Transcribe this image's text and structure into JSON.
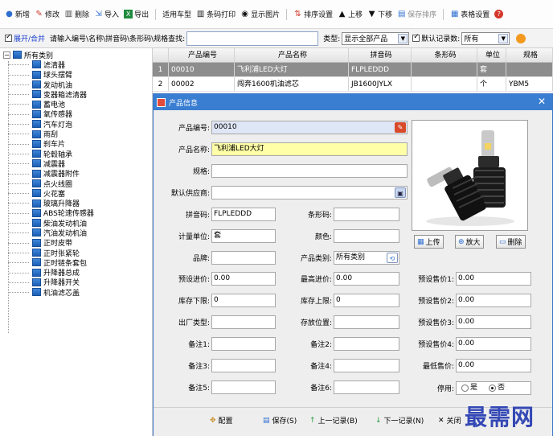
{
  "toolbar": {
    "items": [
      {
        "label": "新增",
        "icon": "add-circle-icon",
        "color": "#2f6fd1"
      },
      {
        "label": "修改",
        "icon": "pencil-icon",
        "color": "#d4382a"
      },
      {
        "label": "删除",
        "icon": "trash-icon",
        "color": "#444444"
      },
      {
        "label": "导入",
        "icon": "import-icon",
        "color": "#2f6fd1"
      },
      {
        "label": "导出",
        "icon": "excel-icon",
        "color": "#1e8a3c"
      },
      {
        "label": "适用车型",
        "icon": "",
        "color": ""
      },
      {
        "label": "条码打印",
        "icon": "barcode-icon",
        "color": "#222222"
      },
      {
        "label": "显示图片",
        "icon": "eye-icon",
        "color": "#222222"
      },
      {
        "label": "排序设置",
        "icon": "sort-icon",
        "color": "#d4382a"
      },
      {
        "label": "上移",
        "icon": "up-arrow-icon",
        "color": "#333333"
      },
      {
        "label": "下移",
        "icon": "down-arrow-icon",
        "color": "#333333"
      },
      {
        "label": "保存排序",
        "icon": "save-sort-icon",
        "color": "#2f6fd1"
      },
      {
        "label": "表格设置",
        "icon": "table-settings-icon",
        "color": "#2f6fd1"
      },
      {
        "label": "?",
        "icon": "help-icon",
        "color": "#d4382a"
      }
    ]
  },
  "filter": {
    "expand_label": "展开/合并",
    "search_label": "请输入编号\\名称\\拼音码\\条形码\\规格查找:",
    "type_label": "类型:",
    "type_value": "显示全部产品",
    "default_label": "默认记录数:",
    "default_value": "所有"
  },
  "tree": {
    "root": "所有类别",
    "items": [
      "滤清器",
      "球头摆臂",
      "发动机油",
      "变器箱滤清器",
      "蓄电池",
      "氧传感器",
      "汽车灯泡",
      "雨刮",
      "刹车片",
      "轮毂轴承",
      "减震器",
      "减震器附件",
      "点火线圈",
      "火花塞",
      "玻璃升降器",
      "ABS轮速传感器",
      "柴油发动机油",
      "汽油发动机油",
      "正时皮带",
      "正时张紧轮",
      "正时链条套包",
      "升降器总成",
      "升降器开关",
      "机油滤芯盖"
    ]
  },
  "grid": {
    "headers": [
      "",
      "产品编号",
      "产品名称",
      "拼音码",
      "条形码",
      "单位",
      "规格"
    ],
    "rows": [
      [
        "1",
        "00010",
        "飞利浦LED大灯",
        "FLPLEDDD",
        "",
        "套",
        ""
      ],
      [
        "2",
        "00002",
        "闯奔1600机油滤芯",
        "JB1600JYLX",
        "",
        "个",
        "YBM5"
      ]
    ]
  },
  "dialog": {
    "title": "产品信息",
    "labels": {
      "code": "产品编号:",
      "name": "产品名称:",
      "spec": "规格:",
      "supplier": "默认供应商:",
      "pinyin": "拼音码:",
      "barcode": "条形码:",
      "unit": "计量单位:",
      "color": "颜色:",
      "brand": "品牌:",
      "category": "产品类别:",
      "pre_cost": "预设进价:",
      "max_cost": "最高进价:",
      "pre_price1": "预设售价1:",
      "stock_low": "库存下限:",
      "stock_high": "库存上限:",
      "pre_price2": "预设售价2:",
      "factory_type": "出厂类型:",
      "location": "存放位置:",
      "pre_price3": "预设售价3:",
      "note1": "备注1:",
      "note2": "备注2:",
      "pre_price4": "预设售价4:",
      "note3": "备注3:",
      "note4": "备注4:",
      "min_price": "最低售价:",
      "note5": "备注5:",
      "note6": "备注6:",
      "disabled": "停用:"
    },
    "values": {
      "code": "00010",
      "name": "飞利浦LED大灯",
      "spec": "",
      "supplier": "",
      "pinyin": "FLPLEDDD",
      "barcode": "",
      "unit": "套",
      "color": "",
      "brand": "",
      "category": "所有类别",
      "pre_cost": "0.00",
      "max_cost": "0.00",
      "pre_price1": "0.00",
      "stock_low": "0",
      "stock_high": "0",
      "pre_price2": "0.00",
      "factory_type": "",
      "location": "",
      "pre_price3": "0.00",
      "note1": "",
      "note2": "",
      "pre_price4": "0.00",
      "note3": "",
      "note4": "",
      "min_price": "0.00",
      "note5": "",
      "note6": ""
    },
    "radio_yes": "是",
    "radio_no": "否",
    "image_buttons": {
      "upload": "上传",
      "zoom": "放大",
      "delete": "删除"
    },
    "footer": {
      "reset": "配置",
      "save": "保存(S)",
      "prev": "上一记录(B)",
      "next": "下一记录(N)",
      "close": "关闭"
    }
  },
  "watermark": "最需网"
}
